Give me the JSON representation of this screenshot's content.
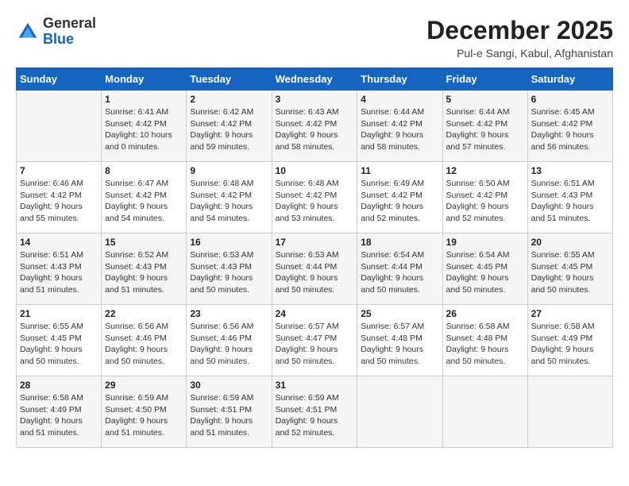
{
  "header": {
    "logo_general": "General",
    "logo_blue": "Blue",
    "month_year": "December 2025",
    "location": "Pul-e Sangi, Kabul, Afghanistan"
  },
  "weekdays": [
    "Sunday",
    "Monday",
    "Tuesday",
    "Wednesday",
    "Thursday",
    "Friday",
    "Saturday"
  ],
  "weeks": [
    [
      {
        "day": "",
        "info": ""
      },
      {
        "day": "1",
        "info": "Sunrise: 6:41 AM\nSunset: 4:42 PM\nDaylight: 10 hours\nand 0 minutes."
      },
      {
        "day": "2",
        "info": "Sunrise: 6:42 AM\nSunset: 4:42 PM\nDaylight: 9 hours\nand 59 minutes."
      },
      {
        "day": "3",
        "info": "Sunrise: 6:43 AM\nSunset: 4:42 PM\nDaylight: 9 hours\nand 58 minutes."
      },
      {
        "day": "4",
        "info": "Sunrise: 6:44 AM\nSunset: 4:42 PM\nDaylight: 9 hours\nand 58 minutes."
      },
      {
        "day": "5",
        "info": "Sunrise: 6:44 AM\nSunset: 4:42 PM\nDaylight: 9 hours\nand 57 minutes."
      },
      {
        "day": "6",
        "info": "Sunrise: 6:45 AM\nSunset: 4:42 PM\nDaylight: 9 hours\nand 56 minutes."
      }
    ],
    [
      {
        "day": "7",
        "info": "Sunrise: 6:46 AM\nSunset: 4:42 PM\nDaylight: 9 hours\nand 55 minutes."
      },
      {
        "day": "8",
        "info": "Sunrise: 6:47 AM\nSunset: 4:42 PM\nDaylight: 9 hours\nand 54 minutes."
      },
      {
        "day": "9",
        "info": "Sunrise: 6:48 AM\nSunset: 4:42 PM\nDaylight: 9 hours\nand 54 minutes."
      },
      {
        "day": "10",
        "info": "Sunrise: 6:48 AM\nSunset: 4:42 PM\nDaylight: 9 hours\nand 53 minutes."
      },
      {
        "day": "11",
        "info": "Sunrise: 6:49 AM\nSunset: 4:42 PM\nDaylight: 9 hours\nand 52 minutes."
      },
      {
        "day": "12",
        "info": "Sunrise: 6:50 AM\nSunset: 4:42 PM\nDaylight: 9 hours\nand 52 minutes."
      },
      {
        "day": "13",
        "info": "Sunrise: 6:51 AM\nSunset: 4:43 PM\nDaylight: 9 hours\nand 51 minutes."
      }
    ],
    [
      {
        "day": "14",
        "info": "Sunrise: 6:51 AM\nSunset: 4:43 PM\nDaylight: 9 hours\nand 51 minutes."
      },
      {
        "day": "15",
        "info": "Sunrise: 6:52 AM\nSunset: 4:43 PM\nDaylight: 9 hours\nand 51 minutes."
      },
      {
        "day": "16",
        "info": "Sunrise: 6:53 AM\nSunset: 4:43 PM\nDaylight: 9 hours\nand 50 minutes."
      },
      {
        "day": "17",
        "info": "Sunrise: 6:53 AM\nSunset: 4:44 PM\nDaylight: 9 hours\nand 50 minutes."
      },
      {
        "day": "18",
        "info": "Sunrise: 6:54 AM\nSunset: 4:44 PM\nDaylight: 9 hours\nand 50 minutes."
      },
      {
        "day": "19",
        "info": "Sunrise: 6:54 AM\nSunset: 4:45 PM\nDaylight: 9 hours\nand 50 minutes."
      },
      {
        "day": "20",
        "info": "Sunrise: 6:55 AM\nSunset: 4:45 PM\nDaylight: 9 hours\nand 50 minutes."
      }
    ],
    [
      {
        "day": "21",
        "info": "Sunrise: 6:55 AM\nSunset: 4:45 PM\nDaylight: 9 hours\nand 50 minutes."
      },
      {
        "day": "22",
        "info": "Sunrise: 6:56 AM\nSunset: 4:46 PM\nDaylight: 9 hours\nand 50 minutes."
      },
      {
        "day": "23",
        "info": "Sunrise: 6:56 AM\nSunset: 4:46 PM\nDaylight: 9 hours\nand 50 minutes."
      },
      {
        "day": "24",
        "info": "Sunrise: 6:57 AM\nSunset: 4:47 PM\nDaylight: 9 hours\nand 50 minutes."
      },
      {
        "day": "25",
        "info": "Sunrise: 6:57 AM\nSunset: 4:48 PM\nDaylight: 9 hours\nand 50 minutes."
      },
      {
        "day": "26",
        "info": "Sunrise: 6:58 AM\nSunset: 4:48 PM\nDaylight: 9 hours\nand 50 minutes."
      },
      {
        "day": "27",
        "info": "Sunrise: 6:58 AM\nSunset: 4:49 PM\nDaylight: 9 hours\nand 50 minutes."
      }
    ],
    [
      {
        "day": "28",
        "info": "Sunrise: 6:58 AM\nSunset: 4:49 PM\nDaylight: 9 hours\nand 51 minutes."
      },
      {
        "day": "29",
        "info": "Sunrise: 6:59 AM\nSunset: 4:50 PM\nDaylight: 9 hours\nand 51 minutes."
      },
      {
        "day": "30",
        "info": "Sunrise: 6:59 AM\nSunset: 4:51 PM\nDaylight: 9 hours\nand 51 minutes."
      },
      {
        "day": "31",
        "info": "Sunrise: 6:59 AM\nSunset: 4:51 PM\nDaylight: 9 hours\nand 52 minutes."
      },
      {
        "day": "",
        "info": ""
      },
      {
        "day": "",
        "info": ""
      },
      {
        "day": "",
        "info": ""
      }
    ]
  ]
}
